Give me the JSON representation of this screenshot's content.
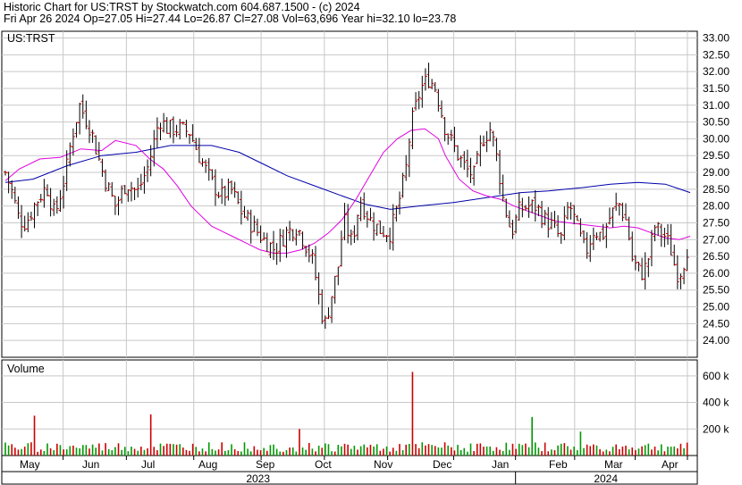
{
  "header": {
    "line1": "Historic Chart for US:TRST by Stockwatch.com 604.687.1500 - (c) 2024",
    "line2": "Fri Apr 26 2024  Op=27.05  Hi=27.44  Lo=26.87  Cl=27.08  Vol=63,696  Year hi=32.10  lo=23.78"
  },
  "chart_data": [
    {
      "type": "ohlc",
      "ticker_label": "US:TRST",
      "ylim": [
        23.5,
        33.2
      ],
      "y_ticks": [
        "24.00",
        "24.50",
        "25.00",
        "25.50",
        "26.00",
        "26.50",
        "27.00",
        "27.50",
        "28.00",
        "28.50",
        "29.00",
        "29.50",
        "30.00",
        "30.50",
        "31.00",
        "31.50",
        "32.00",
        "32.50",
        "33.00"
      ],
      "x_months": [
        "May",
        "Jun",
        "Jul",
        "Aug",
        "Sep",
        "Oct",
        "Nov",
        "Dec",
        "Jan",
        "Feb",
        "Mar",
        "Apr"
      ],
      "x_years": [
        "2023",
        "2024"
      ],
      "series": [
        {
          "color": "#0000aa",
          "values": [
            [
              0,
              28.7
            ],
            [
              20,
              28.8
            ],
            [
              45,
              29.2
            ],
            [
              70,
              29.5
            ],
            [
              95,
              29.6
            ],
            [
              120,
              29.8
            ],
            [
              150,
              29.8
            ],
            [
              170,
              29.6
            ],
            [
              190,
              29.2
            ],
            [
              205,
              28.9
            ],
            [
              225,
              28.6
            ],
            [
              245,
              28.3
            ],
            [
              262,
              28.05
            ],
            [
              280,
              27.9
            ],
            [
              300,
              28.0
            ],
            [
              325,
              28.1
            ],
            [
              350,
              28.25
            ],
            [
              375,
              28.4
            ],
            [
              395,
              28.45
            ],
            [
              420,
              28.55
            ],
            [
              440,
              28.65
            ],
            [
              460,
              28.7
            ],
            [
              480,
              28.65
            ],
            [
              498,
              28.4
            ]
          ]
        },
        {
          "color": "#e000e0",
          "values": [
            [
              0,
              28.75
            ],
            [
              10,
              29.1
            ],
            [
              25,
              29.4
            ],
            [
              40,
              29.45
            ],
            [
              55,
              29.7
            ],
            [
              70,
              29.65
            ],
            [
              80,
              29.95
            ],
            [
              95,
              29.8
            ],
            [
              105,
              29.4
            ],
            [
              115,
              29.1
            ],
            [
              125,
              28.6
            ],
            [
              135,
              28.0
            ],
            [
              150,
              27.4
            ],
            [
              165,
              27.1
            ],
            [
              175,
              26.9
            ],
            [
              185,
              26.7
            ],
            [
              195,
              26.6
            ],
            [
              205,
              26.6
            ],
            [
              215,
              26.7
            ],
            [
              225,
              26.9
            ],
            [
              235,
              27.2
            ],
            [
              245,
              27.6
            ],
            [
              255,
              28.2
            ],
            [
              265,
              28.9
            ],
            [
              275,
              29.6
            ],
            [
              285,
              30.0
            ],
            [
              295,
              30.25
            ],
            [
              305,
              30.3
            ],
            [
              315,
              30.0
            ],
            [
              320,
              29.5
            ],
            [
              330,
              28.8
            ],
            [
              340,
              28.45
            ],
            [
              350,
              28.3
            ],
            [
              360,
              28.2
            ],
            [
              370,
              28.0
            ],
            [
              380,
              27.85
            ],
            [
              390,
              27.7
            ],
            [
              400,
              27.55
            ],
            [
              410,
              27.5
            ],
            [
              420,
              27.45
            ],
            [
              430,
              27.4
            ],
            [
              440,
              27.35
            ],
            [
              450,
              27.4
            ],
            [
              460,
              27.35
            ],
            [
              470,
              27.2
            ],
            [
              480,
              27.05
            ],
            [
              490,
              27.0
            ],
            [
              498,
              27.1
            ]
          ]
        }
      ],
      "price_anchors": [
        [
          0,
          29.0
        ],
        [
          5,
          28.4
        ],
        [
          10,
          27.6
        ],
        [
          15,
          27.5
        ],
        [
          22,
          28.1
        ],
        [
          30,
          28.6
        ],
        [
          36,
          27.7
        ],
        [
          44,
          29.0
        ],
        [
          48,
          30.0
        ],
        [
          54,
          31.0
        ],
        [
          62,
          30.3
        ],
        [
          70,
          29.1
        ],
        [
          76,
          28.4
        ],
        [
          80,
          28.0
        ],
        [
          88,
          28.7
        ],
        [
          96,
          28.4
        ],
        [
          104,
          29.2
        ],
        [
          112,
          30.6
        ],
        [
          118,
          30.3
        ],
        [
          126,
          30.3
        ],
        [
          134,
          30.2
        ],
        [
          142,
          29.4
        ],
        [
          150,
          28.7
        ],
        [
          157,
          28.3
        ],
        [
          164,
          28.5
        ],
        [
          172,
          27.8
        ],
        [
          180,
          27.4
        ],
        [
          188,
          27.0
        ],
        [
          196,
          26.7
        ],
        [
          204,
          27.2
        ],
        [
          212,
          27.4
        ],
        [
          218,
          26.9
        ],
        [
          224,
          26.3
        ],
        [
          228,
          25.3
        ],
        [
          232,
          24.4
        ],
        [
          237,
          25.3
        ],
        [
          242,
          26.2
        ],
        [
          246,
          27.6
        ],
        [
          252,
          26.9
        ],
        [
          258,
          28.2
        ],
        [
          265,
          27.6
        ],
        [
          272,
          27.3
        ],
        [
          280,
          27.2
        ],
        [
          286,
          28.1
        ],
        [
          291,
          29.0
        ],
        [
          295,
          30.4
        ],
        [
          302,
          31.5
        ],
        [
          308,
          31.8
        ],
        [
          313,
          31.5
        ],
        [
          320,
          30.3
        ],
        [
          328,
          29.6
        ],
        [
          335,
          29.1
        ],
        [
          341,
          28.9
        ],
        [
          347,
          30.0
        ],
        [
          353,
          30.3
        ],
        [
          358,
          29.3
        ],
        [
          362,
          28.2
        ],
        [
          368,
          27.2
        ],
        [
          374,
          27.9
        ],
        [
          380,
          28.0
        ],
        [
          386,
          28.0
        ],
        [
          392,
          27.6
        ],
        [
          398,
          27.4
        ],
        [
          404,
          27.0
        ],
        [
          410,
          28.1
        ],
        [
          416,
          27.3
        ],
        [
          422,
          26.6
        ],
        [
          428,
          27.3
        ],
        [
          434,
          27.1
        ],
        [
          440,
          27.7
        ],
        [
          446,
          28.1
        ],
        [
          452,
          27.5
        ],
        [
          456,
          26.4
        ],
        [
          460,
          26.1
        ],
        [
          464,
          26.0
        ],
        [
          468,
          26.5
        ],
        [
          472,
          27.4
        ],
        [
          476,
          27.2
        ],
        [
          480,
          27.1
        ],
        [
          484,
          26.7
        ],
        [
          488,
          26.0
        ],
        [
          492,
          26.1
        ],
        [
          498,
          27.1
        ]
      ],
      "price_color": "#cc0000",
      "price_seed": 7
    },
    {
      "type": "bar",
      "title": "Volume",
      "ylim": [
        0,
        720
      ],
      "y_ticks": [
        "200 k",
        "400 k",
        "600 k"
      ],
      "volume_base": 80,
      "volume_spikes": [
        [
          20,
          300
        ],
        [
          105,
          310
        ],
        [
          215,
          200
        ],
        [
          297,
          630
        ],
        [
          382,
          290
        ],
        [
          419,
          180
        ]
      ],
      "volume_seed": 19,
      "up_color": "#009900",
      "down_color": "#cc0000"
    }
  ]
}
